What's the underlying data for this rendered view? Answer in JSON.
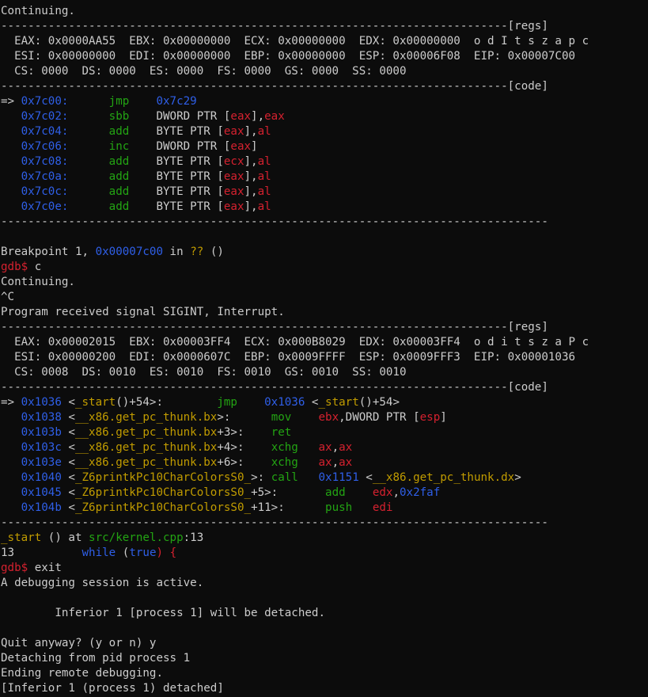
{
  "terminal": {
    "lines": [
      [
        [
          "Continuing.",
          "white"
        ]
      ],
      [
        [
          "---------------------------------------------------------------------------[regs]",
          "white"
        ]
      ],
      [
        [
          "  EAX: 0x0000AA55  EBX: 0x00000000  ECX: 0x00000000  EDX: 0x00000000  o d I t s z a p c",
          "white"
        ]
      ],
      [
        [
          "  ESI: 0x00000000  EDI: 0x00000000  EBP: 0x00000000  ESP: 0x00006F08  EIP: 0x00007C00",
          "white"
        ]
      ],
      [
        [
          "  CS: 0000  DS: 0000  ES: 0000  FS: 0000  GS: 0000  SS: 0000",
          "white"
        ]
      ],
      [
        [
          "---------------------------------------------------------------------------[code]",
          "white"
        ]
      ],
      [
        [
          "=> ",
          "white"
        ],
        [
          "0x7c00:",
          "blue"
        ],
        [
          "      ",
          "white"
        ],
        [
          "jmp",
          "green"
        ],
        [
          "    ",
          "white"
        ],
        [
          "0x7c29",
          "blue"
        ]
      ],
      [
        [
          "   ",
          "white"
        ],
        [
          "0x7c02:",
          "blue"
        ],
        [
          "      ",
          "white"
        ],
        [
          "sbb",
          "green"
        ],
        [
          "    DWORD PTR [",
          "white"
        ],
        [
          "eax",
          "red"
        ],
        [
          "],",
          "white"
        ],
        [
          "eax",
          "red"
        ]
      ],
      [
        [
          "   ",
          "white"
        ],
        [
          "0x7c04:",
          "blue"
        ],
        [
          "      ",
          "white"
        ],
        [
          "add",
          "green"
        ],
        [
          "    BYTE PTR [",
          "white"
        ],
        [
          "eax",
          "red"
        ],
        [
          "],",
          "white"
        ],
        [
          "al",
          "red"
        ]
      ],
      [
        [
          "   ",
          "white"
        ],
        [
          "0x7c06:",
          "blue"
        ],
        [
          "      ",
          "white"
        ],
        [
          "inc",
          "green"
        ],
        [
          "    DWORD PTR [",
          "white"
        ],
        [
          "eax",
          "red"
        ],
        [
          "]",
          "white"
        ]
      ],
      [
        [
          "   ",
          "white"
        ],
        [
          "0x7c08:",
          "blue"
        ],
        [
          "      ",
          "white"
        ],
        [
          "add",
          "green"
        ],
        [
          "    BYTE PTR [",
          "white"
        ],
        [
          "ecx",
          "red"
        ],
        [
          "],",
          "white"
        ],
        [
          "al",
          "red"
        ]
      ],
      [
        [
          "   ",
          "white"
        ],
        [
          "0x7c0a:",
          "blue"
        ],
        [
          "      ",
          "white"
        ],
        [
          "add",
          "green"
        ],
        [
          "    BYTE PTR [",
          "white"
        ],
        [
          "eax",
          "red"
        ],
        [
          "],",
          "white"
        ],
        [
          "al",
          "red"
        ]
      ],
      [
        [
          "   ",
          "white"
        ],
        [
          "0x7c0c:",
          "blue"
        ],
        [
          "      ",
          "white"
        ],
        [
          "add",
          "green"
        ],
        [
          "    BYTE PTR [",
          "white"
        ],
        [
          "eax",
          "red"
        ],
        [
          "],",
          "white"
        ],
        [
          "al",
          "red"
        ]
      ],
      [
        [
          "   ",
          "white"
        ],
        [
          "0x7c0e:",
          "blue"
        ],
        [
          "      ",
          "white"
        ],
        [
          "add",
          "green"
        ],
        [
          "    BYTE PTR [",
          "white"
        ],
        [
          "eax",
          "red"
        ],
        [
          "],",
          "white"
        ],
        [
          "al",
          "red"
        ]
      ],
      [
        [
          "---------------------------------------------------------------------------------",
          "white"
        ]
      ],
      [
        [
          "",
          "white"
        ]
      ],
      [
        [
          "Breakpoint 1, ",
          "white"
        ],
        [
          "0x00007c00",
          "blue"
        ],
        [
          " in ",
          "white"
        ],
        [
          "??",
          "yellow"
        ],
        [
          " ()",
          "white"
        ]
      ],
      [
        [
          "gdb$",
          "red"
        ],
        [
          " c",
          "white"
        ]
      ],
      [
        [
          "Continuing.",
          "white"
        ]
      ],
      [
        [
          "^C",
          "white"
        ]
      ],
      [
        [
          "Program received signal SIGINT, Interrupt.",
          "white"
        ]
      ],
      [
        [
          "---------------------------------------------------------------------------[regs]",
          "white"
        ]
      ],
      [
        [
          "  EAX: 0x00002015  EBX: 0x00003FF4  ECX: 0x000B8029  EDX: 0x00003FF4  o d i t s z a P c",
          "white"
        ]
      ],
      [
        [
          "  ESI: 0x00000200  EDI: 0x0000607C  EBP: 0x0009FFFF  ESP: 0x0009FFF3  EIP: 0x00001036",
          "white"
        ]
      ],
      [
        [
          "  CS: 0008  DS: 0010  ES: 0010  FS: 0010  GS: 0010  SS: 0010",
          "white"
        ]
      ],
      [
        [
          "---------------------------------------------------------------------------[code]",
          "white"
        ]
      ],
      [
        [
          "=> ",
          "white"
        ],
        [
          "0x1036",
          "blue"
        ],
        [
          " <",
          "white"
        ],
        [
          "_start",
          "yellow"
        ],
        [
          "()+54>:        ",
          "white"
        ],
        [
          "jmp",
          "green"
        ],
        [
          "    ",
          "white"
        ],
        [
          "0x1036",
          "blue"
        ],
        [
          " <",
          "white"
        ],
        [
          "_start",
          "yellow"
        ],
        [
          "()+54>",
          "white"
        ]
      ],
      [
        [
          "   ",
          "white"
        ],
        [
          "0x1038",
          "blue"
        ],
        [
          " <",
          "white"
        ],
        [
          "__x86.get_pc_thunk.bx",
          "yellow"
        ],
        [
          ">:      ",
          "white"
        ],
        [
          "mov",
          "green"
        ],
        [
          "    ",
          "white"
        ],
        [
          "ebx",
          "red"
        ],
        [
          ",DWORD PTR [",
          "white"
        ],
        [
          "esp",
          "red"
        ],
        [
          "]",
          "white"
        ]
      ],
      [
        [
          "   ",
          "white"
        ],
        [
          "0x103b",
          "blue"
        ],
        [
          " <",
          "white"
        ],
        [
          "__x86.get_pc_thunk.bx",
          "yellow"
        ],
        [
          "+3>:    ",
          "white"
        ],
        [
          "ret",
          "green"
        ]
      ],
      [
        [
          "   ",
          "white"
        ],
        [
          "0x103c",
          "blue"
        ],
        [
          " <",
          "white"
        ],
        [
          "__x86.get_pc_thunk.bx",
          "yellow"
        ],
        [
          "+4>:    ",
          "white"
        ],
        [
          "xchg",
          "green"
        ],
        [
          "   ",
          "white"
        ],
        [
          "ax",
          "red"
        ],
        [
          ",",
          "white"
        ],
        [
          "ax",
          "red"
        ]
      ],
      [
        [
          "   ",
          "white"
        ],
        [
          "0x103e",
          "blue"
        ],
        [
          " <",
          "white"
        ],
        [
          "__x86.get_pc_thunk.bx",
          "yellow"
        ],
        [
          "+6>:    ",
          "white"
        ],
        [
          "xchg",
          "green"
        ],
        [
          "   ",
          "white"
        ],
        [
          "ax",
          "red"
        ],
        [
          ",",
          "white"
        ],
        [
          "ax",
          "red"
        ]
      ],
      [
        [
          "   ",
          "white"
        ],
        [
          "0x1040",
          "blue"
        ],
        [
          " <",
          "white"
        ],
        [
          "_Z6printkPc10CharColorsS0_",
          "yellow"
        ],
        [
          ">: ",
          "white"
        ],
        [
          "call",
          "green"
        ],
        [
          "   ",
          "white"
        ],
        [
          "0x1151",
          "blue"
        ],
        [
          " <",
          "white"
        ],
        [
          "__x86.get_pc_thunk.dx",
          "yellow"
        ],
        [
          ">",
          "white"
        ]
      ],
      [
        [
          "   ",
          "white"
        ],
        [
          "0x1045",
          "blue"
        ],
        [
          " <",
          "white"
        ],
        [
          "_Z6printkPc10CharColorsS0_",
          "yellow"
        ],
        [
          "+5>:       ",
          "white"
        ],
        [
          "add",
          "green"
        ],
        [
          "    ",
          "white"
        ],
        [
          "edx",
          "red"
        ],
        [
          ",",
          "white"
        ],
        [
          "0x2faf",
          "blue"
        ]
      ],
      [
        [
          "   ",
          "white"
        ],
        [
          "0x104b",
          "blue"
        ],
        [
          " <",
          "white"
        ],
        [
          "_Z6printkPc10CharColorsS0_",
          "yellow"
        ],
        [
          "+11>:      ",
          "white"
        ],
        [
          "push",
          "green"
        ],
        [
          "   ",
          "white"
        ],
        [
          "edi",
          "red"
        ]
      ],
      [
        [
          "---------------------------------------------------------------------------------",
          "white"
        ]
      ],
      [
        [
          "_start",
          "yellow"
        ],
        [
          " () at ",
          "white"
        ],
        [
          "src/kernel.cpp",
          "green"
        ],
        [
          ":13",
          "white"
        ]
      ],
      [
        [
          "13",
          "white"
        ],
        [
          "          ",
          "white"
        ],
        [
          "while",
          "blue"
        ],
        [
          " (",
          "white"
        ],
        [
          "true",
          "blue"
        ],
        [
          ") {",
          "red"
        ]
      ],
      [
        [
          "gdb$",
          "red"
        ],
        [
          " exit",
          "white"
        ]
      ],
      [
        [
          "A debugging session is active.",
          "white"
        ]
      ],
      [
        [
          "",
          "white"
        ]
      ],
      [
        [
          "        Inferior 1 [process 1] will be detached.",
          "white"
        ]
      ],
      [
        [
          "",
          "white"
        ]
      ],
      [
        [
          "Quit anyway? (y or n) y",
          "white"
        ]
      ],
      [
        [
          "Detaching from pid process 1",
          "white"
        ]
      ],
      [
        [
          "Ending remote debugging.",
          "white"
        ]
      ],
      [
        [
          "[Inferior 1 (process 1) detached]",
          "white"
        ]
      ]
    ]
  }
}
